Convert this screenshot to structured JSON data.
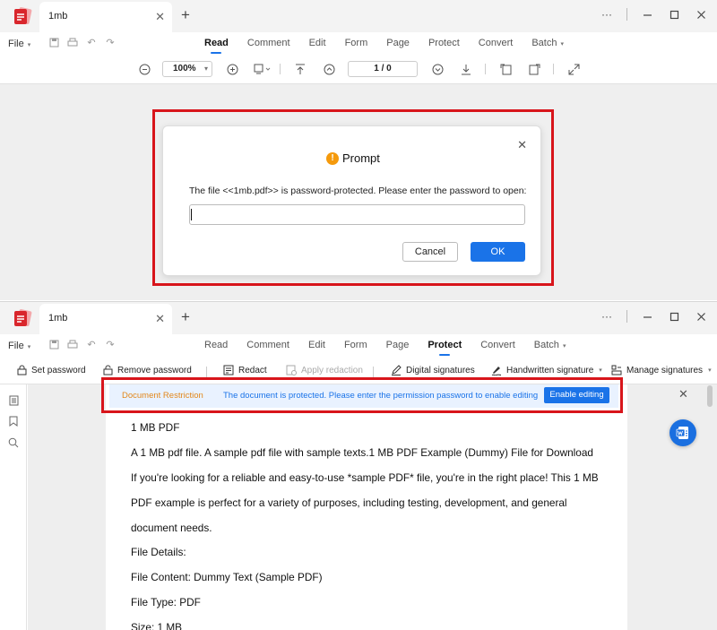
{
  "window1": {
    "tab_title": "1mb",
    "menu": {
      "file": "File",
      "tabs": [
        "Read",
        "Comment",
        "Edit",
        "Form",
        "Page",
        "Protect",
        "Convert",
        "Batch"
      ],
      "active": "Read"
    },
    "toolbar": {
      "zoom": "100%",
      "page": "1 / 0"
    },
    "dialog": {
      "title": "Prompt",
      "message": "The file <<1mb.pdf>> is password-protected. Please enter the password to open:",
      "password_value": "",
      "cancel_label": "Cancel",
      "ok_label": "OK"
    }
  },
  "window2": {
    "tab_title": "1mb",
    "menu": {
      "file": "File",
      "tabs": [
        "Read",
        "Comment",
        "Edit",
        "Form",
        "Page",
        "Protect",
        "Convert",
        "Batch"
      ],
      "active": "Protect"
    },
    "protect_toolbar": {
      "set_password": "Set password",
      "remove_password": "Remove password",
      "redact": "Redact",
      "apply_redaction": "Apply redaction",
      "digital_signatures": "Digital signatures",
      "handwritten_signature": "Handwritten signature",
      "manage_signatures": "Manage signatures"
    },
    "restriction": {
      "label": "Document Restriction",
      "message": "The document is protected. Please enter the permission password to enable editing",
      "enable_label": "Enable editing"
    },
    "document": {
      "lines": [
        "1 MB PDF",
        "A 1 MB pdf file. A sample pdf file with sample texts.1 MB PDF Example (Dummy) File for Download",
        "If you're looking for a reliable and easy-to-use *sample PDF* file, you're in the right place! This 1 MB",
        "PDF example is perfect for a variety of purposes, including testing, development, and general",
        "document needs.",
        "File Details:",
        "File Content: Dummy Text (Sample PDF)",
        "File Type: PDF",
        "Size: 1 MB"
      ]
    }
  },
  "colors": {
    "accent": "#1a73e8",
    "highlight_frame": "#d8151b",
    "warning": "#f59a0c",
    "restriction_label": "#e2871a",
    "logo": "#d9262c"
  },
  "icons": {
    "app_logo": "pdf-app-logo-icon",
    "word_fab": "word-convert-icon"
  }
}
